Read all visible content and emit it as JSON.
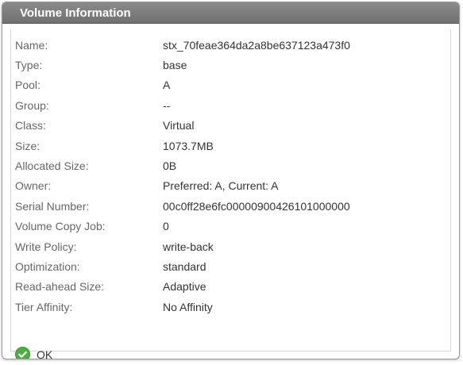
{
  "dialog": {
    "title": "Volume Information",
    "ok_label": "OK"
  },
  "fields": [
    {
      "label": "Name:",
      "value": "stx_70feae364da2a8be637123a473f0"
    },
    {
      "label": "Type:",
      "value": "base"
    },
    {
      "label": "Pool:",
      "value": "A"
    },
    {
      "label": "Group:",
      "value": "--"
    },
    {
      "label": "Class:",
      "value": "Virtual"
    },
    {
      "label": "Size:",
      "value": "1073.7MB"
    },
    {
      "label": "Allocated Size:",
      "value": "0B"
    },
    {
      "label": "Owner:",
      "value": "Preferred: A, Current: A"
    },
    {
      "label": "Serial Number:",
      "value": "00c0ff28e6fc00000900426101000000"
    },
    {
      "label": "Volume Copy Job:",
      "value": "0"
    },
    {
      "label": "Write Policy:",
      "value": "write-back"
    },
    {
      "label": "Optimization:",
      "value": "standard"
    },
    {
      "label": "Read-ahead Size:",
      "value": "Adaptive"
    },
    {
      "label": "Tier Affinity:",
      "value": "No Affinity"
    }
  ],
  "icons": {
    "ok": "check-circle-icon"
  },
  "colors": {
    "titlebar": "#7a7a7a",
    "ok_icon": "#4caf3f"
  }
}
